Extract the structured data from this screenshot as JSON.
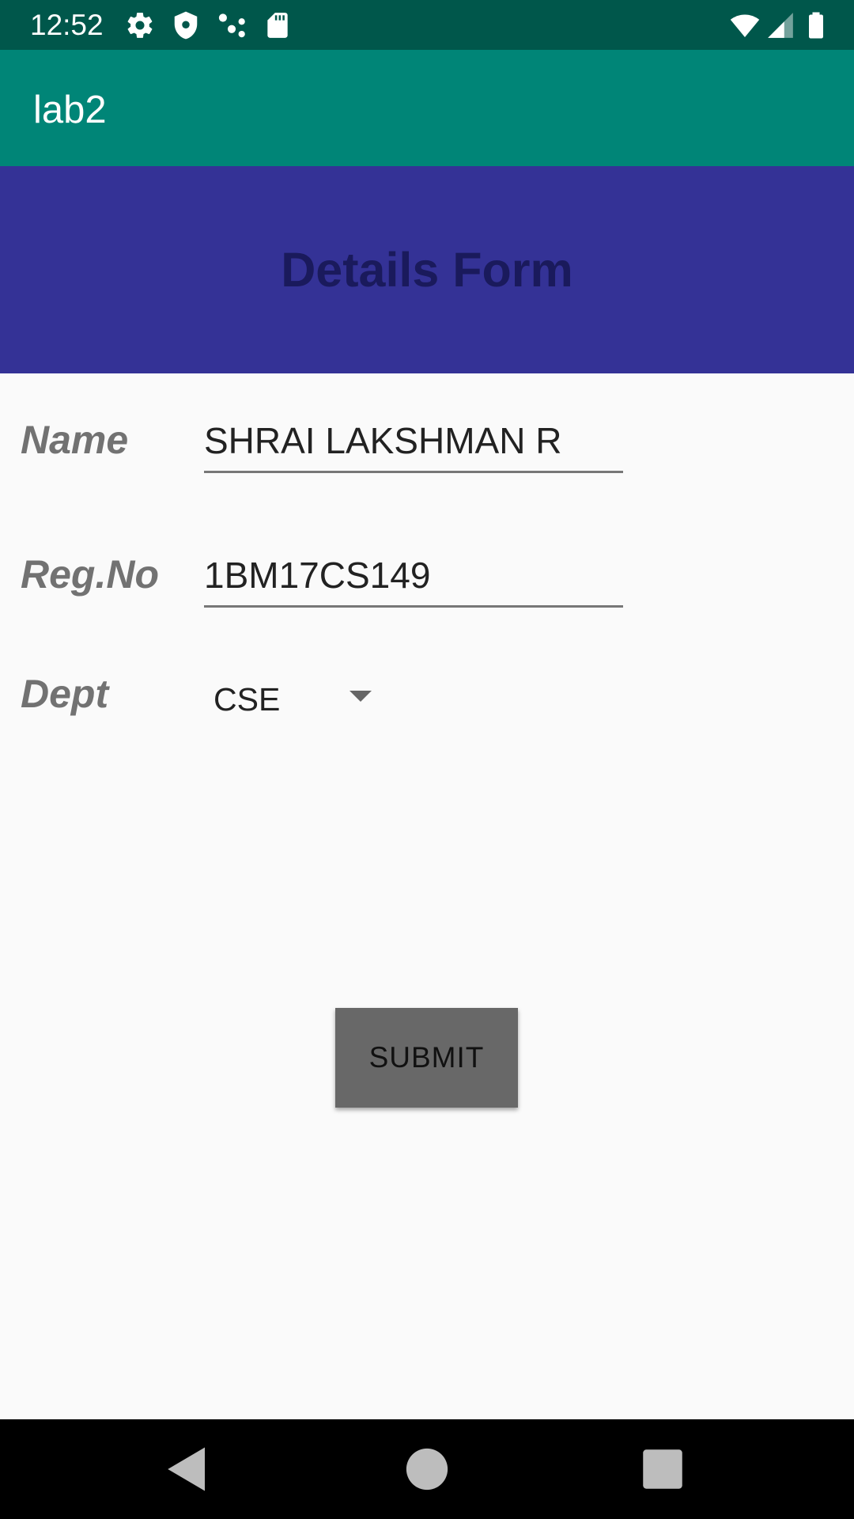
{
  "status_bar": {
    "time": "12:52",
    "left_icons": [
      "gear-icon",
      "shield-icon",
      "share-dots-icon",
      "sd-card-icon"
    ],
    "right_icons": [
      "wifi-icon",
      "signal-icon",
      "battery-icon"
    ]
  },
  "app_bar": {
    "title": "lab2"
  },
  "form": {
    "title": "Details Form",
    "name_label": "Name",
    "name_value": "SHRAI LAKSHMAN R",
    "reg_label": "Reg.No",
    "reg_value": "1BM17CS149",
    "dept_label": "Dept",
    "dept_value": "CSE",
    "submit_label": "SUBMIT"
  },
  "nav_bar": {
    "icons": [
      "back-icon",
      "home-icon",
      "recents-icon"
    ]
  },
  "colors": {
    "status_bar": "#00574b",
    "app_bar": "#008577",
    "header_band": "#343296",
    "form_title": "#1a1a5c",
    "button": "#686868",
    "background": "#fafafa"
  }
}
